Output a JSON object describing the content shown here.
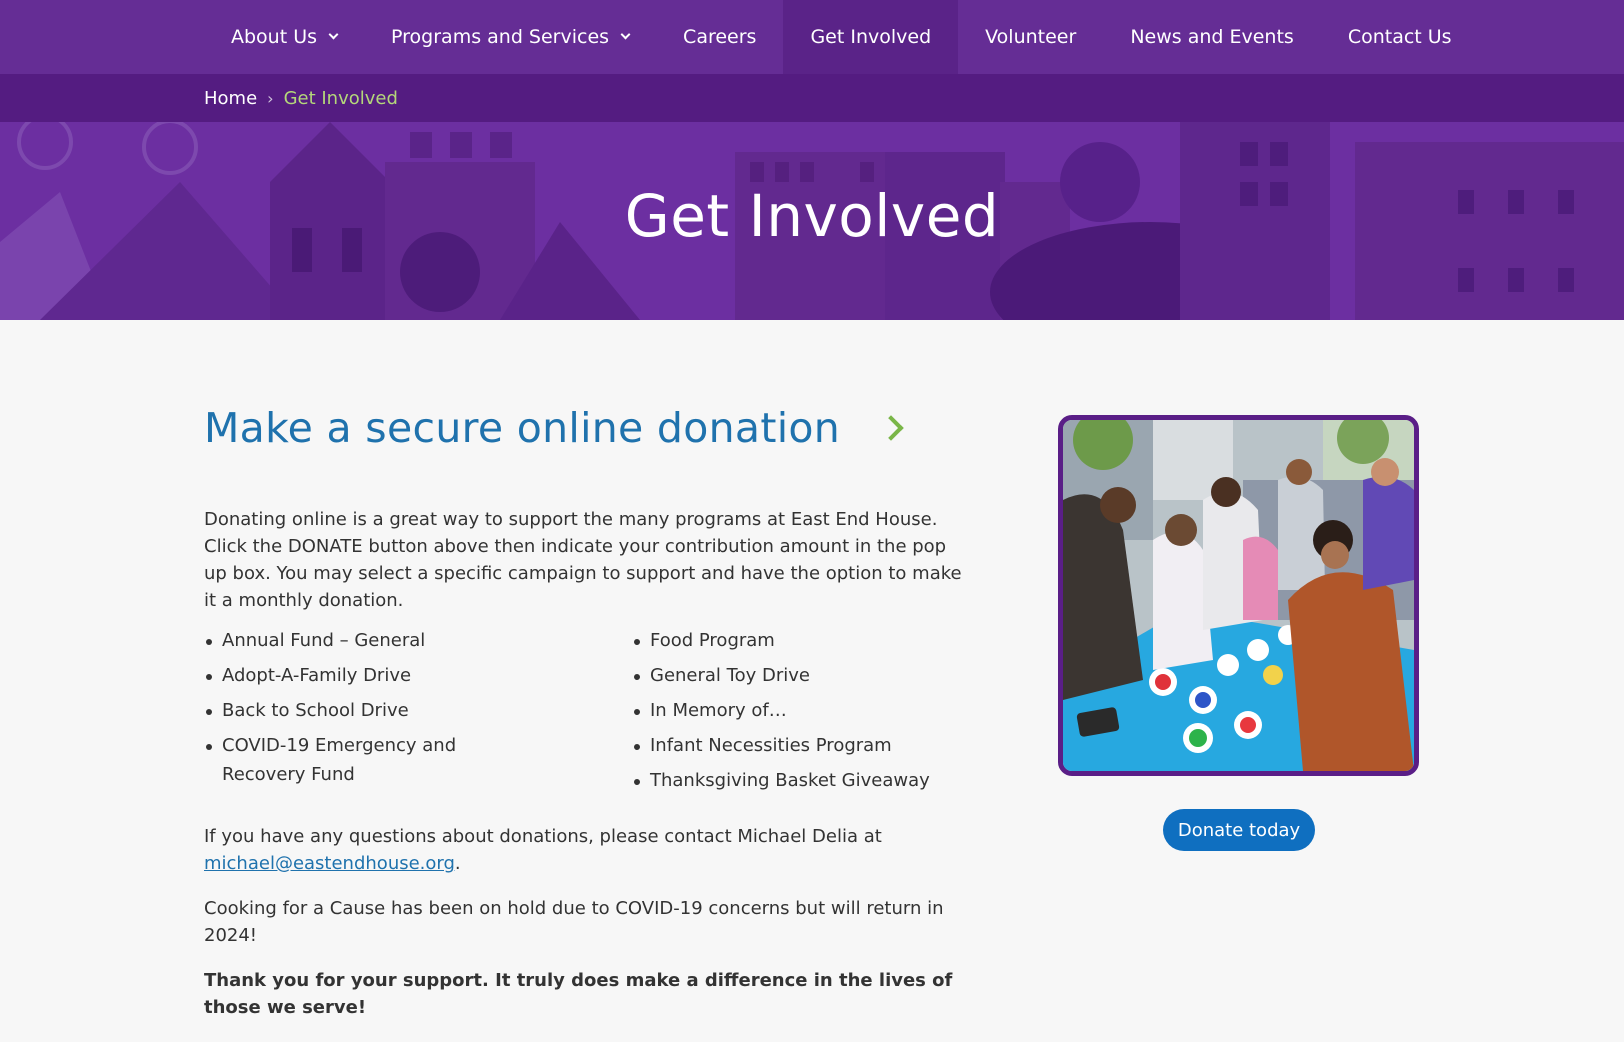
{
  "nav": {
    "items": [
      {
        "label": "About Us",
        "dropdown": true
      },
      {
        "label": "Programs and Services",
        "dropdown": true
      },
      {
        "label": "Careers",
        "dropdown": false
      },
      {
        "label": "Get Involved",
        "dropdown": false,
        "active": true
      },
      {
        "label": "Volunteer",
        "dropdown": false
      },
      {
        "label": "News and Events",
        "dropdown": false
      },
      {
        "label": "Contact Us",
        "dropdown": false
      }
    ]
  },
  "breadcrumb": {
    "home": "Home",
    "separator": "›",
    "current": "Get Involved"
  },
  "hero": {
    "title": "Get Involved"
  },
  "main": {
    "heading": "Make a secure online donation",
    "intro": "Donating online is a great way to support the many programs at East End House. Click the DONATE button above then indicate your contribution amount in the pop up box. You may select a specific campaign to support and have the option to make it a monthly donation.",
    "campaigns_left": [
      "Annual Fund – General",
      "Adopt-A-Family Drive",
      "Back to School Drive",
      "COVID-19 Emergency and Recovery Fund"
    ],
    "campaigns_right": [
      "Food Program",
      "General Toy Drive",
      "In Memory of…",
      "Infant Necessities Program",
      "Thanksgiving Basket Giveaway"
    ],
    "questions_text": "If you have any questions about donations, please contact Michael Delia at",
    "email": "michael@eastendhouse.org",
    "period": ".",
    "cooking_text": "Cooking for a Cause has been on hold due to COVID-19 concerns but will return in 2024!",
    "thanks_text": "Thank you for your support. It truly does make a difference in the lives of those we serve!"
  },
  "side": {
    "donate_button": "Donate today"
  },
  "colors": {
    "nav_bg": "#652d95",
    "breadcrumb_bg": "#541c81",
    "hero_bg": "#6c2fa1",
    "heading_blue": "#1f72ad",
    "accent_green": "#7ab648",
    "button_blue": "#0f6fc0"
  }
}
